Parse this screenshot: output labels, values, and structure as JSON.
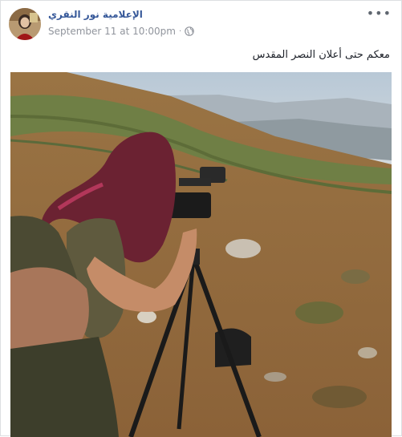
{
  "post": {
    "author_name": "الإعلامية نور النقري",
    "timestamp": "September 11 at 10:00pm",
    "separator": "·",
    "privacy_icon": "globe-icon",
    "more_icon": "ellipsis-icon",
    "more_label": "•••",
    "caption": "معكم حتى أعلان النصر المقدس"
  },
  "photo": {
    "subject": "woman filming with a video camera on a tripod on a dry mountain slope",
    "colors": {
      "sky": "#c7d3dd",
      "ground": "#a0763f",
      "field": "#6e7e43",
      "hair": "#7a2a3a",
      "shirt": "#5e5a3e"
    }
  }
}
